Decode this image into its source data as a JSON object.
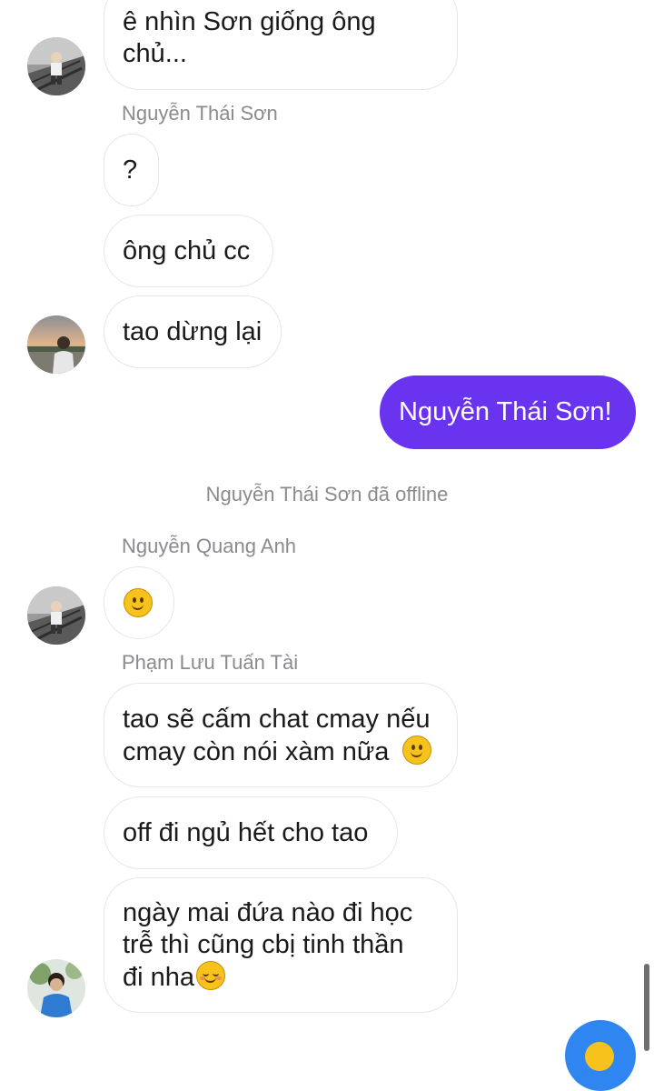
{
  "messages": {
    "m1": "ê nhìn Sơn giống ông\nchủ...",
    "sender_son": "Nguyễn Thái Sơn",
    "m2": "?",
    "m3": "ông chủ cc",
    "m4": "tao dừng lại",
    "m5_mine": "Nguyễn Thái Sơn!",
    "system_offline": "Nguyễn Thái Sơn đã offline",
    "sender_quang_anh": "Nguyễn Quang Anh",
    "sender_tai": "Phạm Lưu Tuấn Tài",
    "m7_line1": "tao sẽ cấm chat cmay nếu",
    "m7_line2": "cmay còn nói xàm nữa",
    "m8": "off đi ngủ hết cho tao",
    "m9_line1": "ngày mai đứa nào đi học",
    "m9_line2": "trễ thì cũng cbị tinh thần",
    "m9_line3": "đi nha"
  },
  "icons": {
    "m6_emoji": "slightly-smiling-face-emoji",
    "m7_emoji": "slightly-smiling-face-emoji",
    "m9_emoji": "smiling-face-emoji",
    "fab": "emoji-reaction-button"
  },
  "colors": {
    "my_bubble": "#6a33f0",
    "fab": "#2f86f0",
    "meta_text": "#8a8a8f"
  }
}
